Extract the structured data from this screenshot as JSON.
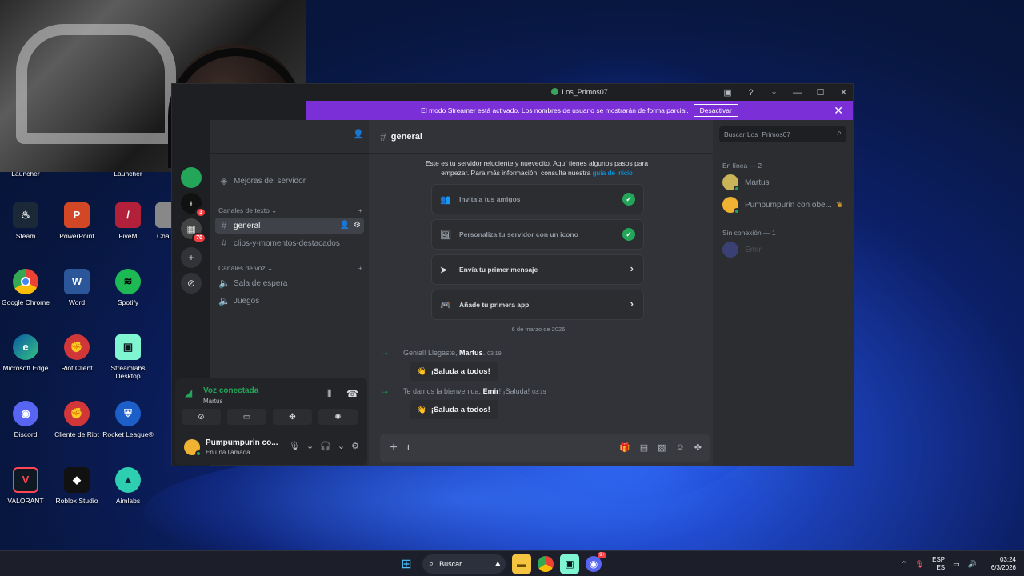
{
  "window": {
    "title": "Los_Primos07",
    "streamer_banner": "El modo Streamer está activado. Los nombres de usuario se mostrarán de forma parcial.",
    "streamer_button": "Desactivar"
  },
  "rail": {
    "badges": [
      "3",
      "70"
    ]
  },
  "channels": {
    "boost": "Mejoras del servidor",
    "text_category": "Canales de texto",
    "text": [
      "general",
      "clips-y-momentos-destacados"
    ],
    "voice_category": "Canales de voz",
    "voice": [
      "Sala de espera",
      "Juegos"
    ]
  },
  "voice_panel": {
    "status": "Voz conectada",
    "sub": "Martus"
  },
  "user": {
    "name": "Pumpumpurin co...",
    "status": "En una llamada"
  },
  "chat": {
    "channel": "general",
    "welcome_text": "Este es tu servidor reluciente y nuevecito. Aquí tienes algunos pasos para empezar. Para más información, consulta nuestra",
    "welcome_link": "guía de inicio",
    "tasks": [
      {
        "label": "Invita a tus amigos",
        "done": true
      },
      {
        "label": "Personaliza tu servidor con un icono",
        "done": true
      },
      {
        "label": "Envía tu primer mensaje",
        "done": false
      },
      {
        "label": "Añade tu primera app",
        "done": false
      }
    ],
    "date": "6 de marzo de 2026",
    "messages": [
      {
        "pre": "¡Genial! Llegaste, ",
        "name": "Martus",
        "post": ".",
        "time": "03:19",
        "button": "¡Saluda a todos!"
      },
      {
        "pre": "¡Te damos la bienvenida, ",
        "name": "Emir",
        "post": "! ¡Saluda!",
        "time": "03:19",
        "button": "¡Saluda a todos!"
      }
    ],
    "composer_text": "t"
  },
  "members": {
    "search_placeholder": "Buscar Los_Primos07",
    "online_header": "En línea — 2",
    "online": [
      "Martus",
      "Pumpumpurin con obe..."
    ],
    "offline_header": "Sin conexión — 1",
    "offline": [
      "Emir"
    ]
  },
  "desktop": {
    "icons": [
      {
        "label": "Launcher"
      },
      {
        "label": "Launcher"
      },
      {
        "label": "Steam"
      },
      {
        "label": "PowerPoint"
      },
      {
        "label": "FiveM"
      },
      {
        "label": "Chai"
      },
      {
        "label": "Google Chrome"
      },
      {
        "label": "Word"
      },
      {
        "label": "Spotify"
      },
      {
        "label": "Microsoft Edge"
      },
      {
        "label": "Riot Client"
      },
      {
        "label": "Streamlabs Desktop"
      },
      {
        "label": "Discord"
      },
      {
        "label": "Cliente de Riot"
      },
      {
        "label": "Rocket League®"
      },
      {
        "label": "VALORANT"
      },
      {
        "label": "Roblox Studio"
      },
      {
        "label": "Aimlabs"
      }
    ]
  },
  "taskbar": {
    "search": "Buscar",
    "lang1": "ESP",
    "lang2": "ES",
    "time": "03:24",
    "date": "6/3/2026",
    "discord_badge": "9+"
  }
}
